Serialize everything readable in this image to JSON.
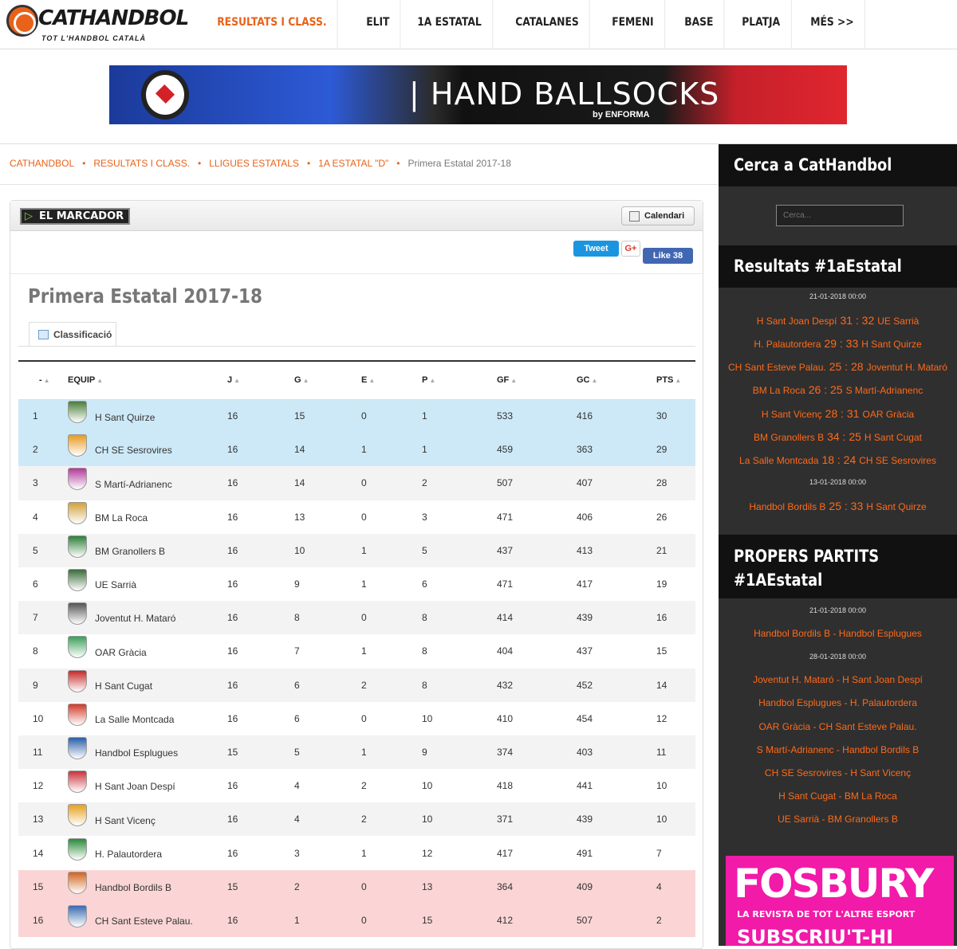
{
  "site": {
    "logo_text": "CATHANDBOL",
    "tagline": "TOT L'HANDBOL CATALÀ"
  },
  "nav": [
    {
      "label": "RESULTATS I CLASS.",
      "active": true
    },
    {
      "label": "ELIT",
      "active": false
    },
    {
      "label": "1A ESTATAL",
      "active": false
    },
    {
      "label": "CATALANES",
      "active": false
    },
    {
      "label": "FEMENI",
      "active": false
    },
    {
      "label": "BASE",
      "active": false
    },
    {
      "label": "PLATJA",
      "active": false
    },
    {
      "label": "MÉS >>",
      "active": false
    }
  ],
  "banner": {
    "text": "| HAND BALLSOCKS",
    "by": "by ENFORMA"
  },
  "breadcrumb": [
    "CATHANDBOL",
    "RESULTATS I CLASS.",
    "LLIGUES ESTATALS",
    "1A ESTATAL \"D\"",
    "Primera Estatal 2017-18"
  ],
  "widget": {
    "brand": "EL MARCADOR",
    "calendar_button": "Calendari",
    "tweet": "Tweet",
    "gplus": "G+",
    "like": "Like 38",
    "title": "Primera Estatal 2017-18",
    "tab": "Classificació"
  },
  "table": {
    "headers": [
      "-",
      "EQUIP",
      "J",
      "G",
      "E",
      "P",
      "GF",
      "GC",
      "PTS"
    ],
    "rows": [
      {
        "pos": "1",
        "team": "H Sant Quirze",
        "j": "16",
        "g": "15",
        "e": "0",
        "p": "1",
        "gf": "533",
        "gc": "416",
        "pts": "30",
        "zone": "up",
        "crest": "#4a7d3a"
      },
      {
        "pos": "2",
        "team": "CH SE Sesrovires",
        "j": "16",
        "g": "14",
        "e": "1",
        "p": "1",
        "gf": "459",
        "gc": "363",
        "pts": "29",
        "zone": "up",
        "crest": "#e69a1e"
      },
      {
        "pos": "3",
        "team": "S Martí-Adrianenc",
        "j": "16",
        "g": "14",
        "e": "0",
        "p": "2",
        "gf": "507",
        "gc": "407",
        "pts": "28",
        "zone": "alt",
        "crest": "#b23a9a"
      },
      {
        "pos": "4",
        "team": "BM La Roca",
        "j": "16",
        "g": "13",
        "e": "0",
        "p": "3",
        "gf": "471",
        "gc": "406",
        "pts": "26",
        "zone": "",
        "crest": "#d2a03a"
      },
      {
        "pos": "5",
        "team": "BM Granollers B",
        "j": "16",
        "g": "10",
        "e": "1",
        "p": "5",
        "gf": "437",
        "gc": "413",
        "pts": "21",
        "zone": "alt",
        "crest": "#2e7d3a"
      },
      {
        "pos": "6",
        "team": "UE Sarrià",
        "j": "16",
        "g": "9",
        "e": "1",
        "p": "6",
        "gf": "471",
        "gc": "417",
        "pts": "19",
        "zone": "",
        "crest": "#3a6b3a"
      },
      {
        "pos": "7",
        "team": "Joventut H. Mataró",
        "j": "16",
        "g": "8",
        "e": "0",
        "p": "8",
        "gf": "414",
        "gc": "439",
        "pts": "16",
        "zone": "alt",
        "crest": "#555555"
      },
      {
        "pos": "8",
        "team": "OAR Gràcia",
        "j": "16",
        "g": "7",
        "e": "1",
        "p": "8",
        "gf": "404",
        "gc": "437",
        "pts": "15",
        "zone": "",
        "crest": "#3aa05a"
      },
      {
        "pos": "9",
        "team": "H Sant Cugat",
        "j": "16",
        "g": "6",
        "e": "2",
        "p": "8",
        "gf": "432",
        "gc": "452",
        "pts": "14",
        "zone": "alt",
        "crest": "#c62828"
      },
      {
        "pos": "10",
        "team": "La Salle Montcada",
        "j": "16",
        "g": "6",
        "e": "0",
        "p": "10",
        "gf": "410",
        "gc": "454",
        "pts": "12",
        "zone": "",
        "crest": "#d23a2a"
      },
      {
        "pos": "11",
        "team": "Handbol Esplugues",
        "j": "15",
        "g": "5",
        "e": "1",
        "p": "9",
        "gf": "374",
        "gc": "403",
        "pts": "11",
        "zone": "alt",
        "crest": "#2a5fa8"
      },
      {
        "pos": "12",
        "team": "H Sant Joan Despí",
        "j": "16",
        "g": "4",
        "e": "2",
        "p": "10",
        "gf": "418",
        "gc": "441",
        "pts": "10",
        "zone": "",
        "crest": "#c8323a"
      },
      {
        "pos": "13",
        "team": "H Sant Vicenç",
        "j": "16",
        "g": "4",
        "e": "2",
        "p": "10",
        "gf": "371",
        "gc": "439",
        "pts": "10",
        "zone": "alt",
        "crest": "#e6a01e"
      },
      {
        "pos": "14",
        "team": "H. Palautordera",
        "j": "16",
        "g": "3",
        "e": "1",
        "p": "12",
        "gf": "417",
        "gc": "491",
        "pts": "7",
        "zone": "",
        "crest": "#2a8a3a"
      },
      {
        "pos": "15",
        "team": "Handbol Bordils B",
        "j": "15",
        "g": "2",
        "e": "0",
        "p": "13",
        "gf": "364",
        "gc": "409",
        "pts": "4",
        "zone": "down",
        "crest": "#d2641e"
      },
      {
        "pos": "16",
        "team": "CH Sant Esteve Palau.",
        "j": "16",
        "g": "1",
        "e": "0",
        "p": "15",
        "gf": "412",
        "gc": "507",
        "pts": "2",
        "zone": "down",
        "crest": "#3a6bb0"
      }
    ]
  },
  "sidebar": {
    "search_title": "Cerca a CatHandbol",
    "search_placeholder": "Cerca...",
    "results_title": "Resultats #1aEstatal",
    "results": [
      {
        "type": "date",
        "text": "21-01-2018 00:00"
      },
      {
        "type": "match",
        "home": "H Sant Joan Despí",
        "score": "31 : 32",
        "away": "UE Sarrià"
      },
      {
        "type": "match",
        "home": "H. Palautordera",
        "score": "29 : 33",
        "away": "H Sant Quirze"
      },
      {
        "type": "match",
        "home": "CH Sant Esteve Palau.",
        "score": "25 : 28",
        "away": "Joventut H. Mataró"
      },
      {
        "type": "match",
        "home": "BM La Roca",
        "score": "26 : 25",
        "away": "S Martí-Adrianenc"
      },
      {
        "type": "match",
        "home": "H Sant Vicenç",
        "score": "28 : 31",
        "away": "OAR Gràcia"
      },
      {
        "type": "match",
        "home": "BM Granollers B",
        "score": "34 : 25",
        "away": "H Sant Cugat"
      },
      {
        "type": "match",
        "home": "La Salle Montcada",
        "score": "18 : 24",
        "away": "CH SE Sesrovires"
      },
      {
        "type": "date",
        "text": "13-01-2018 00:00"
      },
      {
        "type": "match",
        "home": "Handbol Bordils B",
        "score": "25 : 33",
        "away": "H Sant Quirze"
      }
    ],
    "upcoming_title_1": "PROPERS PARTITS",
    "upcoming_title_2": "#1AEstatal",
    "upcoming": [
      {
        "type": "date",
        "text": "21-01-2018 00:00"
      },
      {
        "type": "fixture",
        "text": "Handbol Bordils B - Handbol Esplugues"
      },
      {
        "type": "date",
        "text": "28-01-2018 00:00"
      },
      {
        "type": "fixture",
        "text": "Joventut H. Mataró - H Sant Joan Despí"
      },
      {
        "type": "fixture",
        "text": "Handbol Esplugues - H. Palautordera"
      },
      {
        "type": "fixture",
        "text": "OAR Gràcia - CH Sant Esteve Palau."
      },
      {
        "type": "fixture",
        "text": "S Martí-Adrianenc - Handbol Bordils B"
      },
      {
        "type": "fixture",
        "text": "CH SE Sesrovires - H Sant Vicenç"
      },
      {
        "type": "fixture",
        "text": "H Sant Cugat - BM La Roca"
      },
      {
        "type": "fixture",
        "text": "UE Sarrià - BM Granollers B"
      }
    ],
    "ad": {
      "title": "FOSBURY",
      "subtitle": "LA REVISTA DE TOT L'ALTRE ESPORT",
      "cta": "SUBSCRIU'T-HI"
    }
  },
  "colors": {
    "accent": "#e8621a",
    "promotion": "#cde9f7",
    "relegation": "#fbd5d5",
    "sidebar_bg": "#2f2f2f"
  }
}
